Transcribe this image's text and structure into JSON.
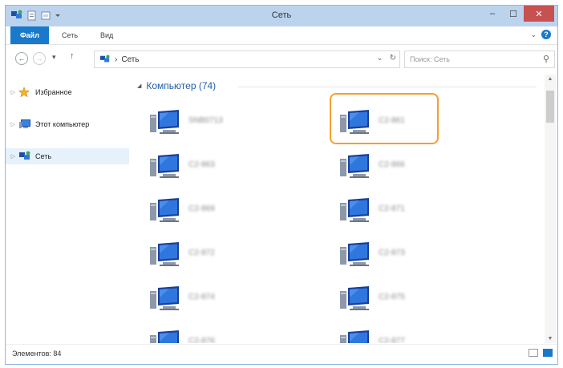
{
  "window": {
    "title": "Сеть",
    "controls": {
      "minimize": "–",
      "maximize": "☐",
      "close": "✕"
    }
  },
  "ribbon": {
    "tabs": [
      {
        "label": "Файл"
      },
      {
        "label": "Сеть"
      },
      {
        "label": "Вид"
      }
    ],
    "expand_glyph": "⌄",
    "help_glyph": "?"
  },
  "navigation": {
    "back_glyph": "←",
    "forward_glyph": "→",
    "recent_glyph": "▾",
    "up_glyph": "↑"
  },
  "address": {
    "separator": "›",
    "location": "Сеть",
    "dropdown_glyph": "⌄",
    "refresh_glyph": "↻"
  },
  "search": {
    "placeholder": "Поиск: Сеть",
    "icon_glyph": "⚲"
  },
  "sidebar": {
    "items": [
      {
        "label": "Избранное",
        "icon": "star-icon"
      },
      {
        "label": "Этот компьютер",
        "icon": "computer-icon"
      },
      {
        "label": "Сеть",
        "icon": "network-icon",
        "selected": true
      }
    ],
    "expand_glyph": "▷"
  },
  "content": {
    "group_header": "Компьютер (74)",
    "collapse_glyph": "◢",
    "computers": [
      {
        "name": "SNB0713"
      },
      {
        "name": "C2-861"
      },
      {
        "name": "C2-863"
      },
      {
        "name": "C2-866"
      },
      {
        "name": "C2-869"
      },
      {
        "name": "C2-871"
      },
      {
        "name": "C2-872"
      },
      {
        "name": "C2-873"
      },
      {
        "name": "C2-874"
      },
      {
        "name": "C2-875"
      },
      {
        "name": "C2-876"
      },
      {
        "name": "C2-877"
      }
    ],
    "highlighted_index": 1,
    "highlight_color": "#f3a02e"
  },
  "scrollbar": {
    "up_glyph": "▲",
    "down_glyph": "▼"
  },
  "status": {
    "item_count": "Элементов: 84"
  },
  "colors": {
    "accent": "#1979ca",
    "titlebar": "#bcd3ee",
    "close": "#c75050"
  }
}
